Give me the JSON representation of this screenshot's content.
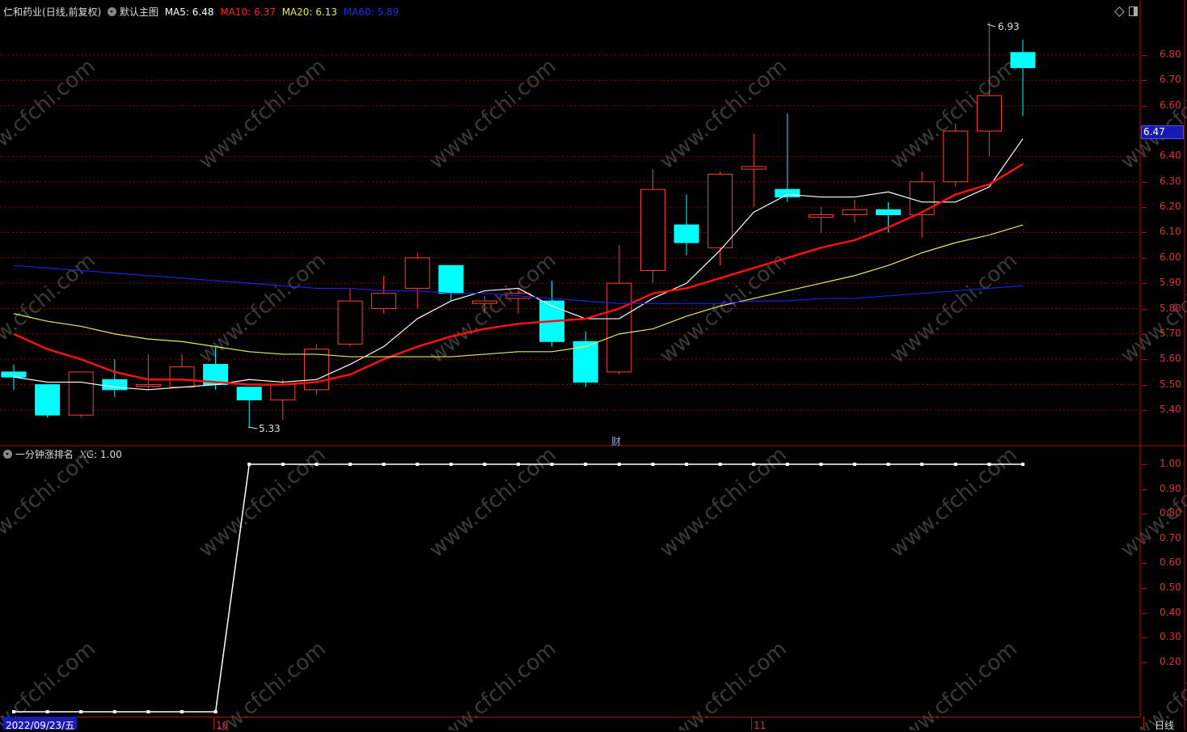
{
  "colors": {
    "bg": "#000000",
    "up": "#ff3d3d",
    "down": "#00ffff",
    "ma5": "#ffffff",
    "ma10": "#ff1010",
    "ma20": "#e8e860",
    "ma60": "#2020e0",
    "grid": "#8a0000",
    "axis": "#b01010",
    "watermark": "#3a3a3a"
  },
  "header": {
    "stock": "仁和药业",
    "period": "(日线,前复权)",
    "template": "默认主图",
    "ma5": "MA5: 6.48",
    "ma10": "MA10: 6.37",
    "ma20": "MA20: 6.13",
    "ma60": "MA60: 5.89"
  },
  "indicator_header": {
    "name": "一分钟涨排名",
    "value": "XG: 1.00"
  },
  "price_axis": [
    "6.80",
    "6.70",
    "6.60",
    "6.40",
    "6.30",
    "6.20",
    "6.10",
    "6.00",
    "5.90",
    "5.80",
    "5.70",
    "5.60",
    "5.50",
    "5.40"
  ],
  "price_marker": "6.47",
  "indicator_axis": [
    "1.00",
    "0.90",
    "0.80",
    "0.70",
    "0.60",
    "0.50",
    "0.40",
    "0.30",
    "0.20"
  ],
  "annotations": {
    "high": "6.93",
    "low": "5.33",
    "finance_marker": "财"
  },
  "bottom_bar": {
    "date": "2022/09/23/五",
    "oct": "10",
    "nov": "11",
    "period_button": "日线"
  },
  "watermark_text": "www.cfchi.com",
  "chart_data": [
    {
      "type": "candlestick",
      "title": "仁和药业 (日线,前复权)",
      "ylim": [
        5.33,
        6.93
      ],
      "candles": [
        {
          "open": 5.55,
          "close": 5.53,
          "high": 5.58,
          "low": 5.48
        },
        {
          "open": 5.5,
          "close": 5.38,
          "high": 5.5,
          "low": 5.37
        },
        {
          "open": 5.38,
          "close": 5.55,
          "high": 5.55,
          "low": 5.37
        },
        {
          "open": 5.52,
          "close": 5.48,
          "high": 5.6,
          "low": 5.45
        },
        {
          "open": 5.5,
          "close": 5.5,
          "high": 5.62,
          "low": 5.48
        },
        {
          "open": 5.49,
          "close": 5.57,
          "high": 5.62,
          "low": 5.49
        },
        {
          "open": 5.58,
          "close": 5.5,
          "high": 5.65,
          "low": 5.48
        },
        {
          "open": 5.49,
          "close": 5.44,
          "high": 5.49,
          "low": 5.33
        },
        {
          "open": 5.44,
          "close": 5.5,
          "high": 5.52,
          "low": 5.36
        },
        {
          "open": 5.48,
          "close": 5.64,
          "high": 5.66,
          "low": 5.46
        },
        {
          "open": 5.66,
          "close": 5.83,
          "high": 5.88,
          "low": 5.65
        },
        {
          "open": 5.8,
          "close": 5.86,
          "high": 5.93,
          "low": 5.78
        },
        {
          "open": 5.88,
          "close": 6.0,
          "high": 6.02,
          "low": 5.8
        },
        {
          "open": 5.97,
          "close": 5.86,
          "high": 5.97,
          "low": 5.83
        },
        {
          "open": 5.82,
          "close": 5.83,
          "high": 5.85,
          "low": 5.78
        },
        {
          "open": 5.84,
          "close": 5.86,
          "high": 5.88,
          "low": 5.78
        },
        {
          "open": 5.83,
          "close": 5.67,
          "high": 5.91,
          "low": 5.65
        },
        {
          "open": 5.67,
          "close": 5.51,
          "high": 5.71,
          "low": 5.49
        },
        {
          "open": 5.55,
          "close": 5.9,
          "high": 6.05,
          "low": 5.54
        },
        {
          "open": 5.95,
          "close": 6.27,
          "high": 6.35,
          "low": 5.9
        },
        {
          "open": 6.13,
          "close": 6.06,
          "high": 6.25,
          "low": 6.01
        },
        {
          "open": 6.04,
          "close": 6.33,
          "high": 6.34,
          "low": 5.97
        },
        {
          "open": 6.35,
          "close": 6.36,
          "high": 6.49,
          "low": 6.2
        },
        {
          "open": 6.27,
          "close": 6.24,
          "high": 6.57,
          "low": 6.22
        },
        {
          "open": 6.16,
          "close": 6.17,
          "high": 6.2,
          "low": 6.1
        },
        {
          "open": 6.17,
          "close": 6.19,
          "high": 6.23,
          "low": 6.14
        },
        {
          "open": 6.19,
          "close": 6.17,
          "high": 6.22,
          "low": 6.1
        },
        {
          "open": 6.17,
          "close": 6.3,
          "high": 6.34,
          "low": 6.08
        },
        {
          "open": 6.3,
          "close": 6.5,
          "high": 6.53,
          "low": 6.28
        },
        {
          "open": 6.5,
          "close": 6.64,
          "high": 6.93,
          "low": 6.4
        },
        {
          "open": 6.81,
          "close": 6.75,
          "high": 6.86,
          "low": 6.56
        }
      ],
      "series": [
        {
          "name": "MA5",
          "values": [
            5.53,
            5.51,
            5.51,
            5.49,
            5.48,
            5.49,
            5.5,
            5.52,
            5.51,
            5.52,
            5.58,
            5.65,
            5.76,
            5.83,
            5.87,
            5.88,
            5.81,
            5.76,
            5.76,
            5.84,
            5.9,
            6.03,
            6.18,
            6.25,
            6.24,
            6.24,
            6.26,
            6.22,
            6.22,
            6.28,
            6.47
          ]
        },
        {
          "name": "MA10",
          "values": [
            5.7,
            5.64,
            5.6,
            5.55,
            5.52,
            5.52,
            5.51,
            5.5,
            5.5,
            5.51,
            5.54,
            5.6,
            5.65,
            5.69,
            5.72,
            5.74,
            5.75,
            5.76,
            5.8,
            5.86,
            5.88,
            5.92,
            5.96,
            6.0,
            6.04,
            6.07,
            6.12,
            6.18,
            6.25,
            6.29,
            6.37
          ]
        },
        {
          "name": "MA20",
          "values": [
            5.78,
            5.75,
            5.73,
            5.7,
            5.68,
            5.67,
            5.65,
            5.63,
            5.62,
            5.62,
            5.61,
            5.61,
            5.61,
            5.61,
            5.62,
            5.63,
            5.63,
            5.65,
            5.7,
            5.72,
            5.77,
            5.81,
            5.84,
            5.87,
            5.9,
            5.93,
            5.97,
            6.02,
            6.06,
            6.09,
            6.13
          ]
        },
        {
          "name": "MA60",
          "values": [
            5.97,
            5.96,
            5.95,
            5.94,
            5.93,
            5.92,
            5.91,
            5.9,
            5.89,
            5.88,
            5.88,
            5.87,
            5.87,
            5.86,
            5.86,
            5.85,
            5.84,
            5.83,
            5.82,
            5.82,
            5.82,
            5.82,
            5.83,
            5.83,
            5.84,
            5.84,
            5.85,
            5.86,
            5.87,
            5.88,
            5.89
          ]
        }
      ]
    },
    {
      "type": "line",
      "title": "一分钟涨排名",
      "ylim": [
        0,
        1
      ],
      "series": [
        {
          "name": "XG",
          "values": [
            0,
            0,
            0,
            0,
            0,
            0,
            0,
            1,
            1,
            1,
            1,
            1,
            1,
            1,
            1,
            1,
            1,
            1,
            1,
            1,
            1,
            1,
            1,
            1,
            1,
            1,
            1,
            1,
            1,
            1,
            1
          ]
        }
      ]
    }
  ]
}
